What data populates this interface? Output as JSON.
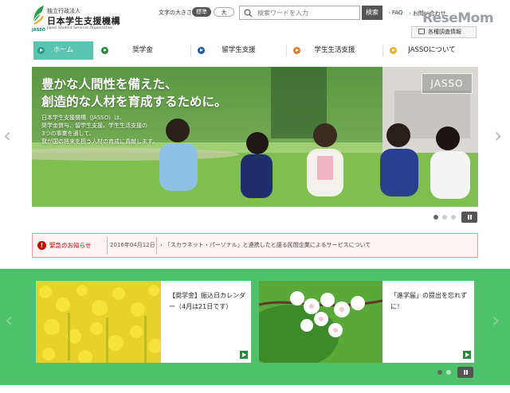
{
  "header": {
    "logo_sub": "独立行政法人",
    "logo_main": "日本学生支援機構",
    "logo_en": "Japan Student Services Organization",
    "logo_abbr": "JASSO",
    "fontsize_label": "文字の大きさ",
    "fontsize_standard": "標準",
    "fontsize_large": "大",
    "search_placeholder": "検索ワードを入力",
    "search_button": "検索",
    "faq": "FAQ",
    "contact": "お問い合わせ",
    "watermark": "ReseMom",
    "survey_button": "各種調査情報"
  },
  "nav": {
    "items": [
      {
        "label": "ホーム",
        "color": "#2a9a88"
      },
      {
        "label": "奨学金",
        "color": "#2a8a3a"
      },
      {
        "label": "留学生支援",
        "color": "#1f5aa6"
      },
      {
        "label": "学生生活支援",
        "color": "#e07a20"
      },
      {
        "label": "JASSOについて",
        "color": "#e8b020"
      }
    ]
  },
  "hero": {
    "title_line1": "豊かな人間性を備えた、",
    "title_line2": "創造的な人材を育成するために。",
    "body_lines": [
      "日本学生支援機構（JASSO）は、",
      "奨学金貸与、留学生支援、学生生活支援の",
      "3つの事業を通して、",
      "我が国の将来を担う人材の育成に貢献します。"
    ],
    "badge": "JASSO",
    "carousel_active": 1,
    "carousel_count": 3
  },
  "emergency": {
    "label": "緊急のお知らせ",
    "date": "2016年04月12日",
    "link": "「スカラネット・パーソナル」と連携したと語る民間企業によるサービスについて"
  },
  "banners": {
    "cards": [
      {
        "text": "【奨学金】振込日カレンダー（4月は21日です）"
      },
      {
        "text": "「進学届」の提出を忘れずに！"
      }
    ],
    "carousel_active": 1,
    "carousel_count": 2
  },
  "colors": {
    "accent_teal": "#5bc3b0",
    "banner_green": "#4ec26a",
    "alert_red": "#cc0000"
  }
}
